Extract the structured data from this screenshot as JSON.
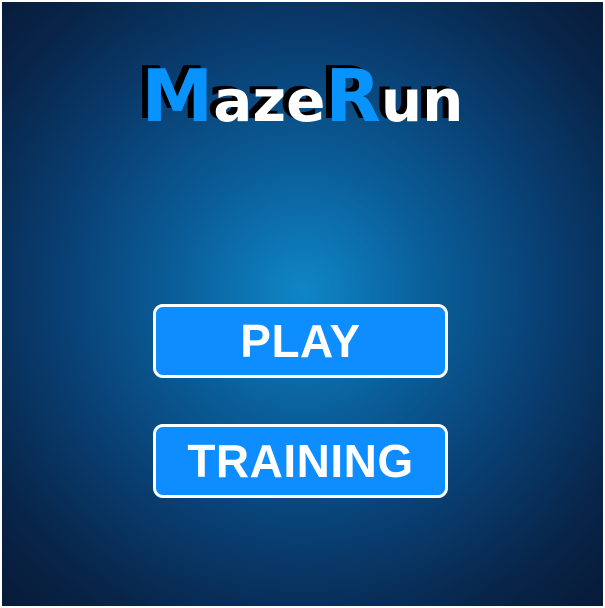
{
  "title": {
    "part1_cap": "M",
    "part1_rest": "aze",
    "part2_cap": "R",
    "part2_rest": "un"
  },
  "menu": {
    "play_label": "PLAY",
    "training_label": "TRAINING"
  },
  "colors": {
    "accent_blue": "#0d8dff",
    "background_center": "#0f86c6",
    "background_edge": "#081a38",
    "button_border": "#ffffff"
  }
}
